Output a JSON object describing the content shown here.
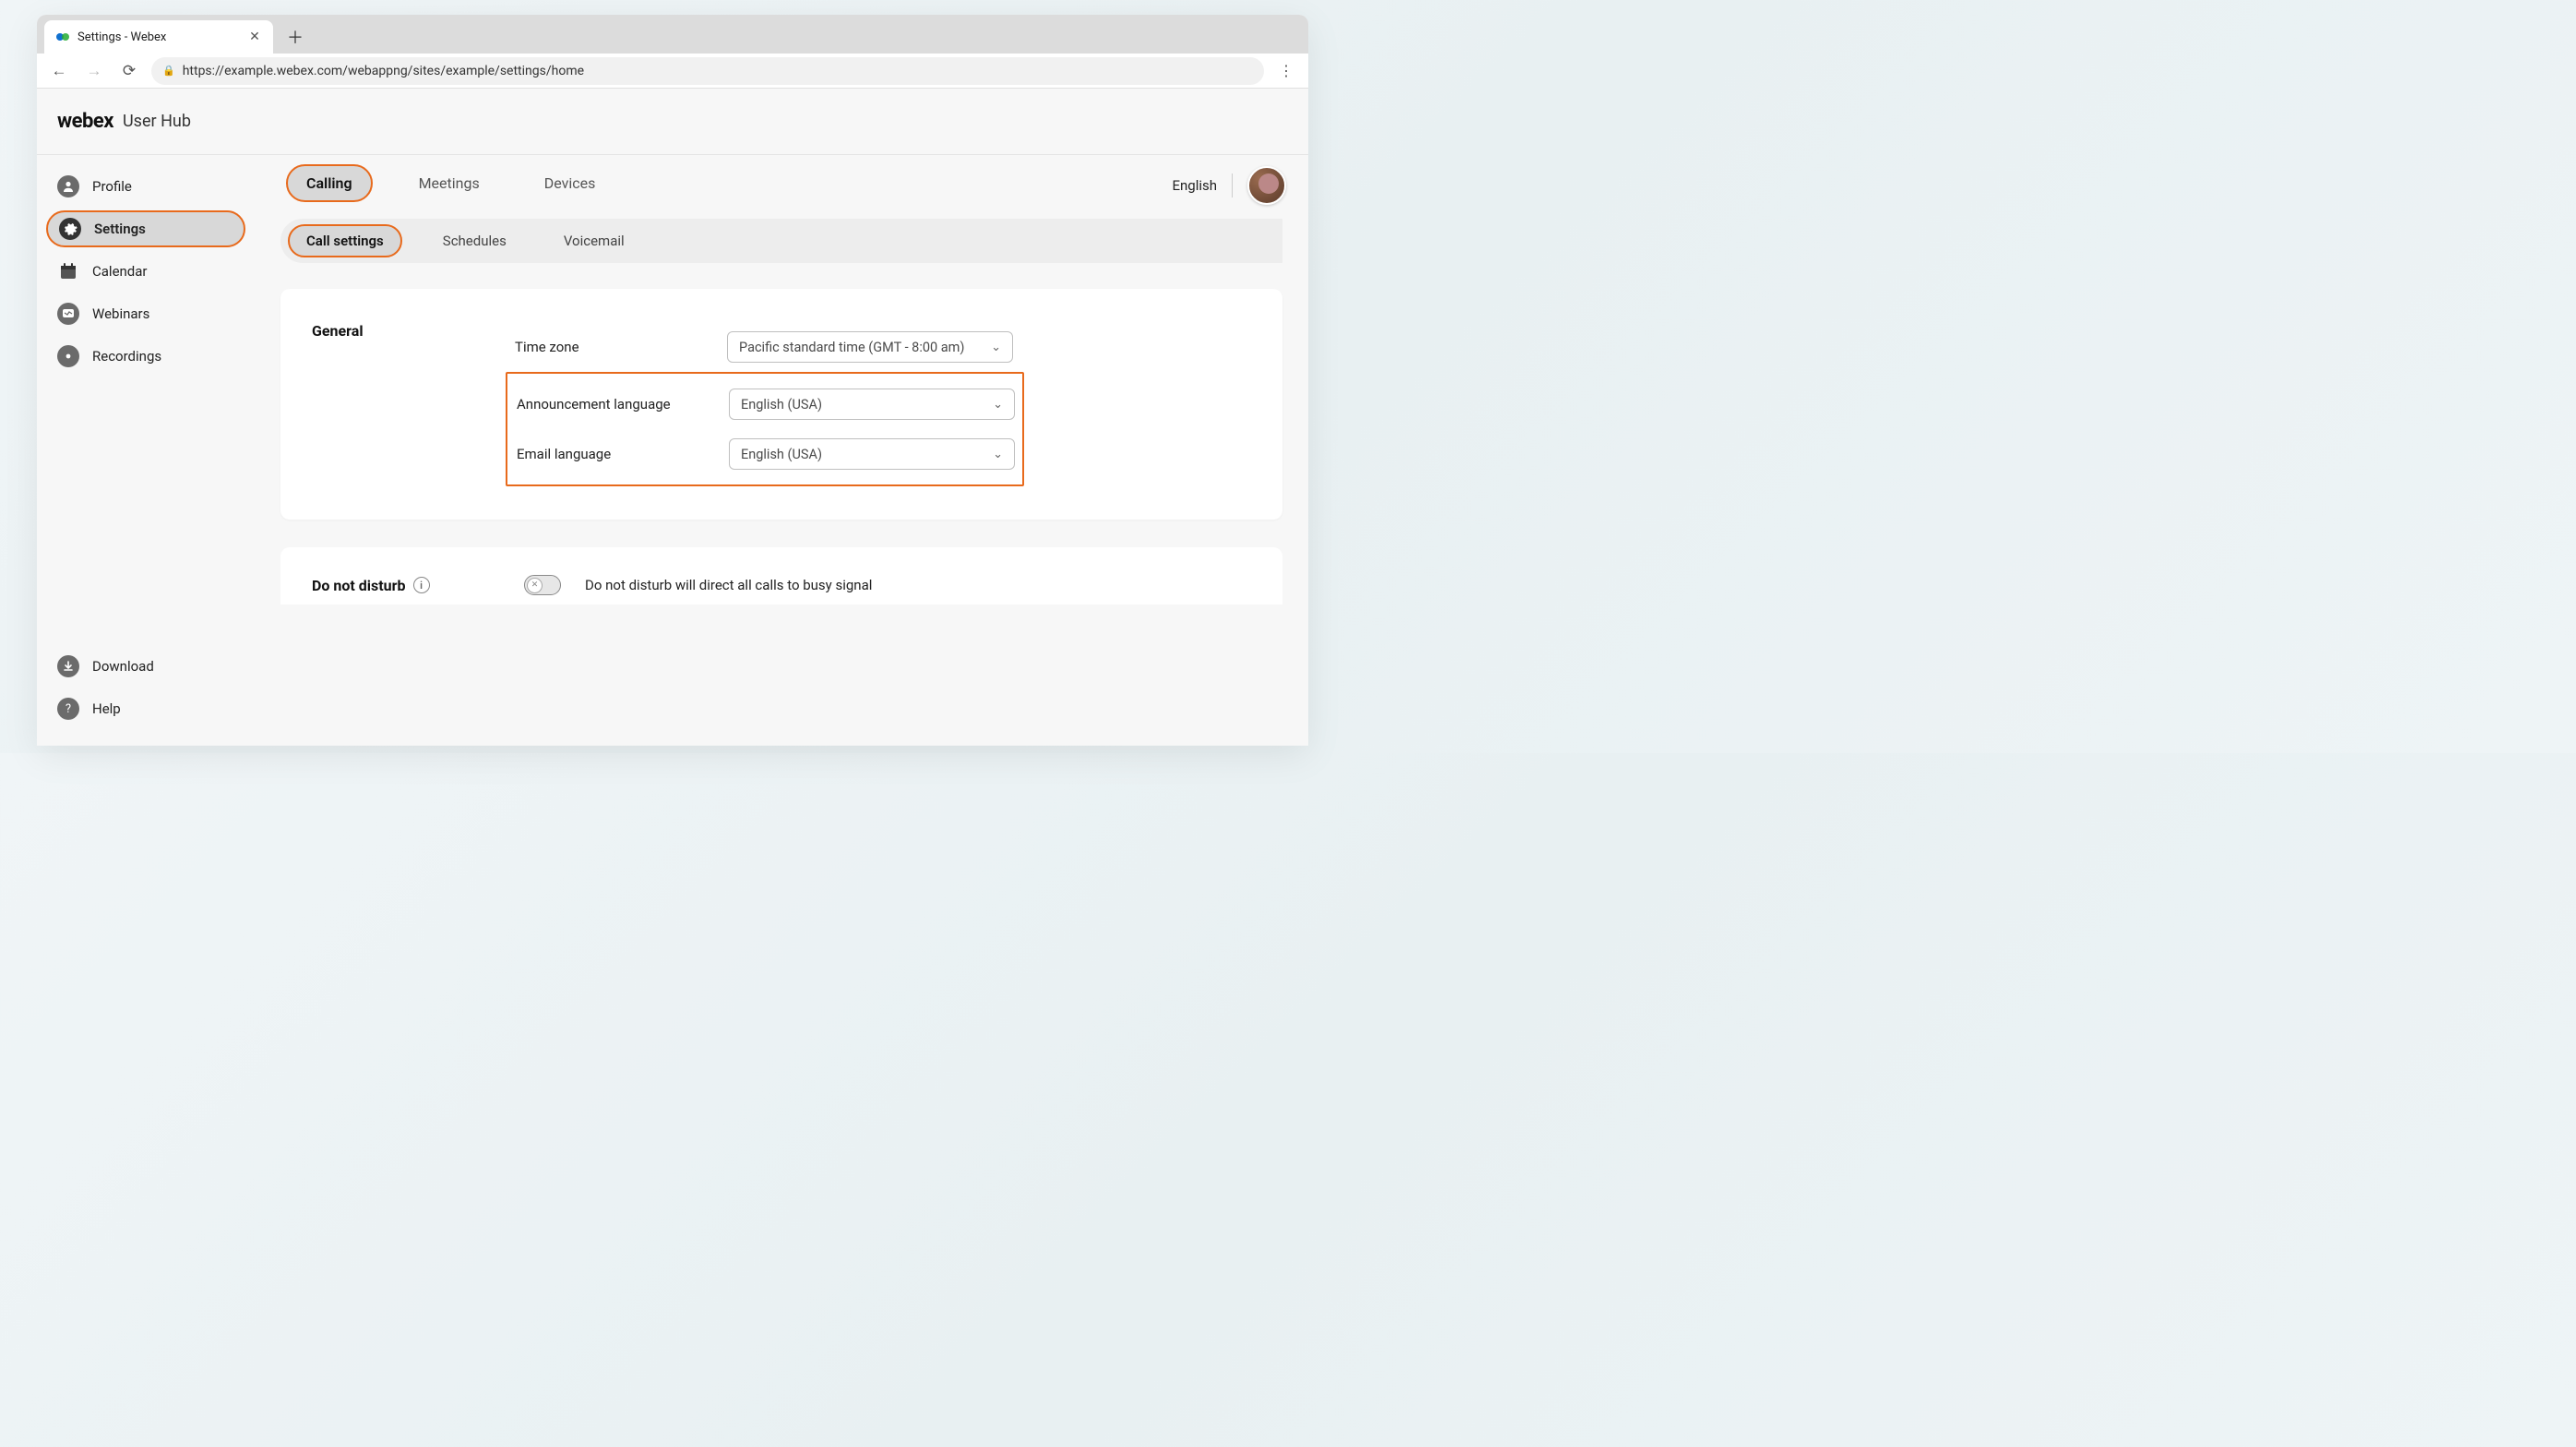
{
  "browser": {
    "tab_title": "Settings - Webex",
    "url": "https://example.webex.com/webappng/sites/example/settings/home"
  },
  "header": {
    "brand": "webex",
    "hub": "User Hub"
  },
  "top_right": {
    "language": "English"
  },
  "sidebar": {
    "items": [
      {
        "label": "Profile"
      },
      {
        "label": "Settings"
      },
      {
        "label": "Calendar"
      },
      {
        "label": "Webinars"
      },
      {
        "label": "Recordings"
      }
    ],
    "bottom": [
      {
        "label": "Download"
      },
      {
        "label": "Help"
      }
    ]
  },
  "tabs": {
    "items": [
      {
        "label": "Calling"
      },
      {
        "label": "Meetings"
      },
      {
        "label": "Devices"
      }
    ]
  },
  "subtabs": {
    "items": [
      {
        "label": "Call settings"
      },
      {
        "label": "Schedules"
      },
      {
        "label": "Voicemail"
      }
    ]
  },
  "general": {
    "heading": "General",
    "timezone_label": "Time zone",
    "timezone_value": "Pacific standard time (GMT - 8:00 am)",
    "announcement_label": "Announcement language",
    "announcement_value": "English (USA)",
    "email_label": "Email language",
    "email_value": "English (USA)"
  },
  "dnd": {
    "heading": "Do not disturb",
    "description": "Do not disturb will direct all calls to busy signal"
  }
}
